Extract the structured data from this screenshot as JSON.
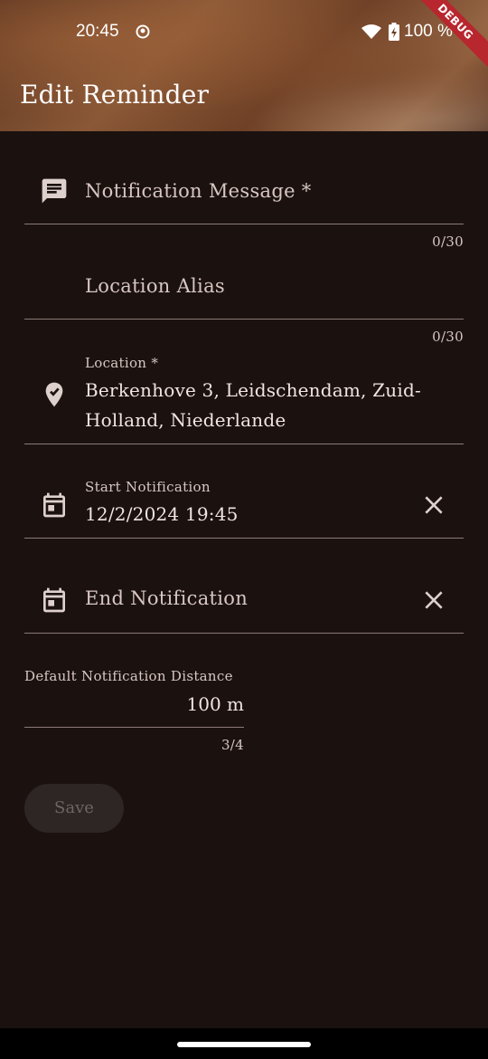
{
  "status_bar": {
    "time": "20:45",
    "battery": "100 %"
  },
  "debug_banner": "DEBUG",
  "app_bar": {
    "title": "Edit Reminder"
  },
  "form": {
    "notification_message": {
      "placeholder": "Notification Message *",
      "value": "",
      "counter": "0/30",
      "icon": "message-icon"
    },
    "location_alias": {
      "placeholder": "Location Alias",
      "value": "",
      "counter": "0/30"
    },
    "location": {
      "label": "Location *",
      "value": "Berkenhove 3, Leidschendam, Zuid-Holland, Niederlande",
      "icon": "location-pin-icon"
    },
    "start_notification": {
      "label": "Start Notification",
      "value": "12/2/2024 19:45",
      "icon": "calendar-icon"
    },
    "end_notification": {
      "placeholder": "End Notification",
      "value": "",
      "icon": "calendar-icon"
    },
    "default_distance": {
      "label": "Default Notification Distance",
      "value": "100 m",
      "counter": "3/4"
    },
    "save_label": "Save"
  },
  "colors": {
    "background": "#1b1210",
    "text": "#ede0dc",
    "underline": "#8a7a76",
    "save_disabled_bg": "#2e2624",
    "debug_banner": "#b8262e"
  }
}
